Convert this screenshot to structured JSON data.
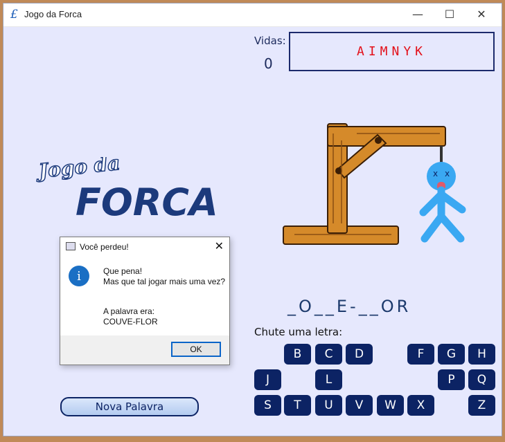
{
  "window": {
    "title": "Jogo da Forca",
    "app_icon": "£",
    "controls": {
      "minimize": "—",
      "maximize": "☐",
      "close": "✕"
    }
  },
  "game": {
    "lives_label": "Vidas:",
    "lives_value": "0",
    "wrong_letters": "AIMNYK",
    "word_display": "_O__E-__OR",
    "guess_label": "Chute uma letra:",
    "new_word_label": "Nova Palavra"
  },
  "logo": {
    "line1": "Jogo da",
    "line2": "FORCA"
  },
  "keys": {
    "B": "B",
    "C": "C",
    "D": "D",
    "F": "F",
    "G": "G",
    "H": "H",
    "J": "J",
    "L": "L",
    "P": "P",
    "Q": "Q",
    "S": "S",
    "T": "T",
    "U": "U",
    "V": "V",
    "W": "W",
    "X": "X",
    "Z": "Z"
  },
  "dialog": {
    "title": "Você perdeu!",
    "line1": "Que pena!",
    "line2": "Mas que tal jogar mais uma vez?",
    "line3": "A palavra era:",
    "line4": "COUVE-FLOR",
    "ok_label": "OK",
    "icon": "i"
  },
  "colors": {
    "background": "#e6e8fd",
    "key_bg": "#0c2364",
    "wrong_letters": "#e3101a",
    "stick_figure": "#3aa8f2"
  }
}
